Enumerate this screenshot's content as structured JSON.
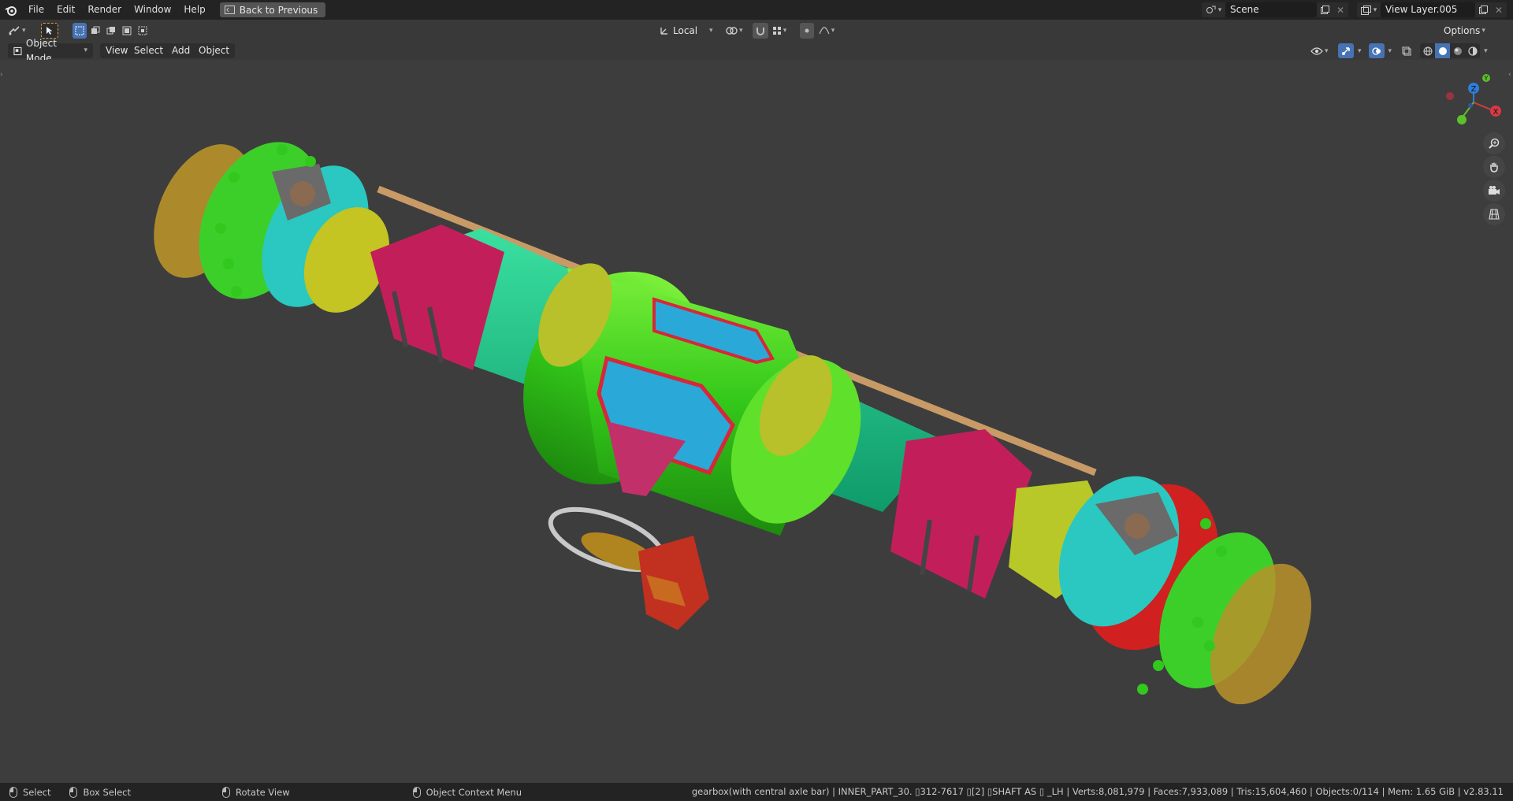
{
  "topbar": {
    "menus": [
      "File",
      "Edit",
      "Render",
      "Window",
      "Help"
    ],
    "back_label": "Back to Previous",
    "scene_name": "Scene",
    "view_layer_name": "View Layer.005"
  },
  "toolbar": {
    "transform_orientation": "Local",
    "options_label": "Options"
  },
  "viewport_header": {
    "mode": "Object Mode",
    "menus": [
      "View",
      "Select",
      "Add",
      "Object"
    ]
  },
  "gizmo": {
    "x_label": "X",
    "y_label": "Y",
    "z_label": "Z"
  },
  "statusbar": {
    "select": "Select",
    "box_select": "Box Select",
    "rotate_view": "Rotate View",
    "context_menu": "Object Context Menu",
    "stats": "gearbox(with central axle bar) | INNER_PART_30. ▯312-7617 ▯[2] ▯SHAFT AS ▯ _LH | Verts:8,081,979 | Faces:7,933,089 | Tris:15,604,460 | Objects:0/114 | Mem: 1.65 GiB | v2.83.11"
  },
  "colors": {
    "topbar_bg": "#232323",
    "viewport_bg": "#3d3d3d",
    "accent_blue": "#4772b3"
  }
}
